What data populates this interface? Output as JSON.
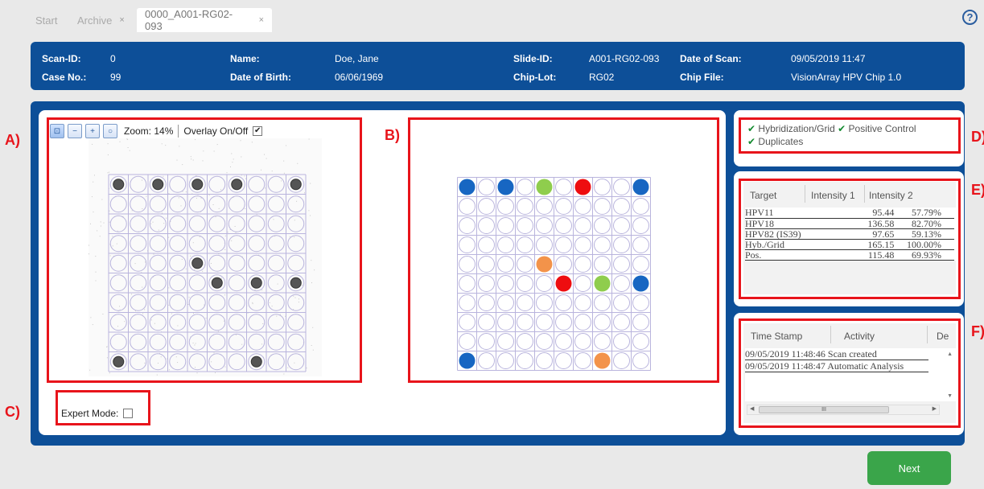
{
  "tabs": [
    {
      "label": "Start",
      "closable": false
    },
    {
      "label": "Archive",
      "closable": true
    },
    {
      "label": "0000_A001-RG02-093",
      "closable": true,
      "active": true
    }
  ],
  "tab_close_glyph": "×",
  "help_glyph": "?",
  "header": {
    "scan_id_label": "Scan-ID:",
    "scan_id": "0",
    "case_no_label": "Case No.:",
    "case_no": "99",
    "name_label": "Name:",
    "name": "Doe, Jane",
    "dob_label": "Date of Birth:",
    "dob": "06/06/1969",
    "slide_id_label": "Slide-ID:",
    "slide_id": "A001-RG02-093",
    "chip_lot_label": "Chip-Lot:",
    "chip_lot": "RG02",
    "date_of_scan_label": "Date of Scan:",
    "date_of_scan": "09/05/2019 11:47",
    "chip_file_label": "Chip File:",
    "chip_file": "VisionArray HPV Chip 1.0"
  },
  "letters": {
    "a": "A)",
    "b": "B)",
    "c": "C)",
    "d": "D)",
    "e": "E)",
    "f": "F)"
  },
  "viewer": {
    "zoom_label": "Zoom: 14%",
    "overlay_label": "Overlay On/Off",
    "overlay_checked": true,
    "tool_icons": [
      "fit-icon",
      "zoom-out-icon",
      "zoom-in-icon",
      "zoom-reset-icon"
    ]
  },
  "expert_mode_label": "Expert Mode:",
  "expert_mode_checked": false,
  "checks": [
    {
      "mark": "✔",
      "label": "Hybridization/Grid"
    },
    {
      "mark": "✔",
      "label": "Positive Control"
    },
    {
      "mark": "✔",
      "label": "Duplicates"
    }
  ],
  "results": {
    "columns": [
      "Target",
      "Intensity 1",
      "Intensity 2"
    ],
    "rows": [
      [
        "HPV11",
        "95.44",
        "57.79%"
      ],
      [
        "HPV18",
        "136.58",
        "82.70%"
      ],
      [
        "HPV82 (IS39)",
        "97.65",
        "59.13%"
      ],
      [
        "Hyb./Grid",
        "165.15",
        "100.00%"
      ],
      [
        "Pos.",
        "115.48",
        "69.93%"
      ]
    ]
  },
  "log": {
    "columns": [
      "Time Stamp",
      "Activity",
      "De"
    ],
    "rows": [
      "09/05/2019 11:48:46 Scan created",
      "09/05/2019 11:48:47 Automatic Analysis"
    ],
    "scroll_thumb_glyph": "III"
  },
  "next_label": "Next",
  "colors": {
    "brand_blue": "#0d4f98",
    "annotation_red": "#e8141b",
    "next_green": "#3aa54a",
    "spot_blue": "#1766c2",
    "spot_green": "#8fcd4d",
    "spot_red": "#ee0d10",
    "spot_orange": "#f3934a",
    "grid_line": "#b9b4dd"
  },
  "scan_grid": {
    "rows": 10,
    "cols": 10,
    "dark_spots": [
      [
        0,
        0
      ],
      [
        0,
        2
      ],
      [
        0,
        4
      ],
      [
        0,
        6
      ],
      [
        0,
        9
      ],
      [
        4,
        4
      ],
      [
        5,
        5
      ],
      [
        5,
        7
      ],
      [
        5,
        9
      ],
      [
        9,
        0
      ],
      [
        9,
        7
      ]
    ]
  },
  "result_grid": {
    "rows": 10,
    "cols": 10,
    "spots": [
      {
        "r": 0,
        "c": 0,
        "color": "blue"
      },
      {
        "r": 0,
        "c": 2,
        "color": "blue"
      },
      {
        "r": 0,
        "c": 4,
        "color": "green"
      },
      {
        "r": 0,
        "c": 6,
        "color": "red"
      },
      {
        "r": 0,
        "c": 9,
        "color": "blue"
      },
      {
        "r": 4,
        "c": 4,
        "color": "orange"
      },
      {
        "r": 5,
        "c": 5,
        "color": "red"
      },
      {
        "r": 5,
        "c": 7,
        "color": "green"
      },
      {
        "r": 5,
        "c": 9,
        "color": "blue"
      },
      {
        "r": 9,
        "c": 0,
        "color": "blue"
      },
      {
        "r": 9,
        "c": 7,
        "color": "orange"
      }
    ]
  }
}
